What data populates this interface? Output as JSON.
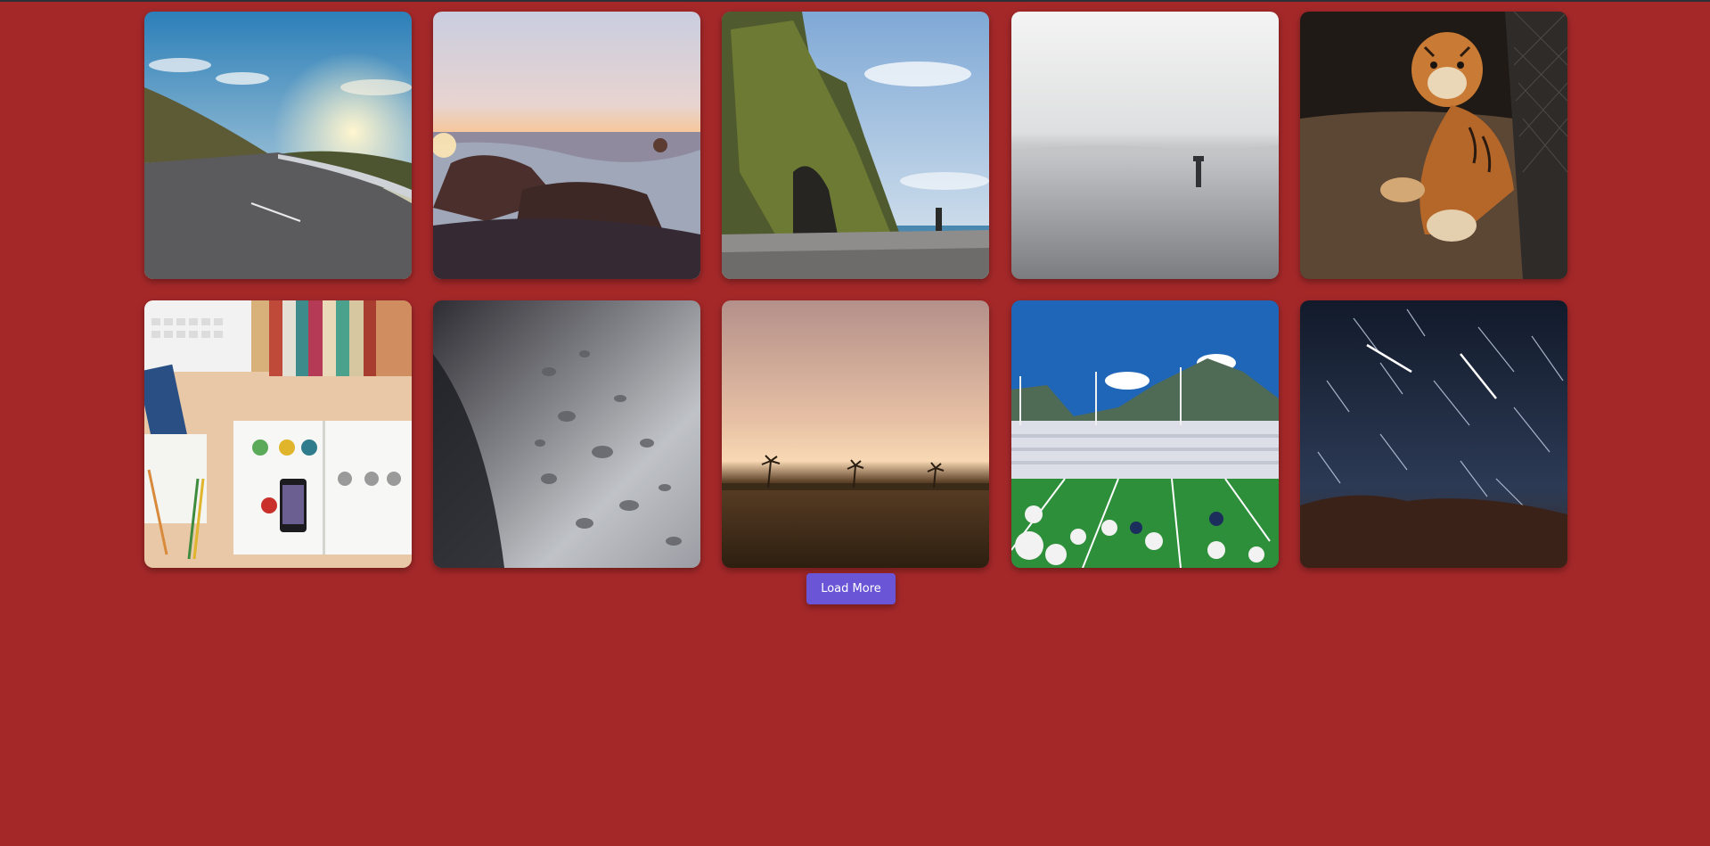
{
  "gallery": {
    "images": [
      {
        "subject": "mountain-road-sunset"
      },
      {
        "subject": "ocean-rocks-sunrise"
      },
      {
        "subject": "sea-cliff-beach"
      },
      {
        "subject": "calm-sea-marker"
      },
      {
        "subject": "tiger-cub"
      },
      {
        "subject": "desk-laptop-books"
      },
      {
        "subject": "water-droplets"
      },
      {
        "subject": "desert-palms-sunset"
      },
      {
        "subject": "football-stadium"
      },
      {
        "subject": "star-trails"
      }
    ]
  },
  "actions": {
    "load_more_label": "Load More"
  },
  "colors": {
    "background": "#a52829",
    "button": "#6a55d6"
  }
}
